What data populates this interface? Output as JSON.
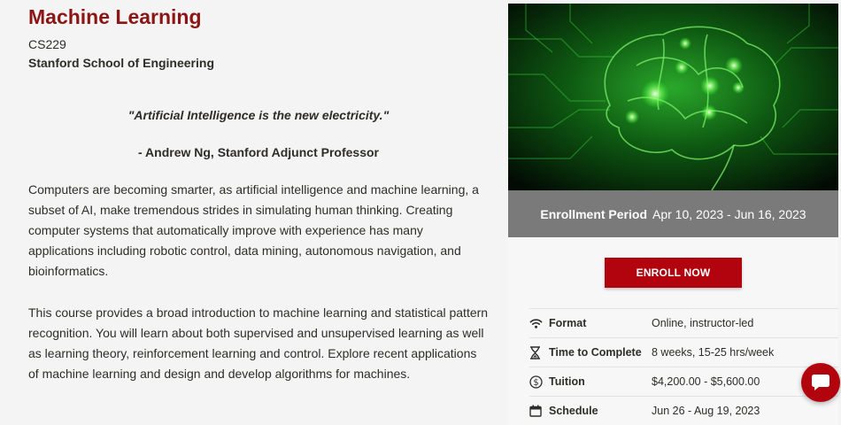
{
  "course": {
    "title": "Machine Learning",
    "code": "CS229",
    "school": "Stanford School of Engineering"
  },
  "quote": {
    "text": "\"Artificial Intelligence is the new electricity.\"",
    "author": "- Andrew Ng, Stanford Adjunct Professor"
  },
  "description": [
    "Computers are becoming smarter, as artificial intelligence and machine learning, a subset of AI, make tremendous strides in simulating human thinking. Creating computer systems that automatically improve with experience has many applications including robotic control, data mining, autonomous navigation, and bioinformatics.",
    "This course provides a broad introduction to machine learning and statistical pattern recognition. You will learn about both supervised and unsupervised learning as well as learning theory, reinforcement learning and control. Explore recent applications of machine learning and design and develop algorithms for machines."
  ],
  "enrollment": {
    "label": "Enrollment Period",
    "dates": "Apr 10, 2023 - Jun 16, 2023",
    "button": "ENROLL NOW"
  },
  "details": [
    {
      "icon": "wifi-icon",
      "key": "Format",
      "value": "Online, instructor-led"
    },
    {
      "icon": "hourglass-icon",
      "key": "Time to Complete",
      "value": "8 weeks, 15-25 hrs/week"
    },
    {
      "icon": "dollar-icon",
      "key": "Tuition",
      "value": "$4,200.00 - $5,600.00"
    },
    {
      "icon": "calendar-icon",
      "key": "Schedule",
      "value": "Jun 26 - Aug 19, 2023"
    }
  ],
  "colors": {
    "brand": "#8c1515",
    "button": "#b1040e",
    "band": "#7a7a7a"
  }
}
